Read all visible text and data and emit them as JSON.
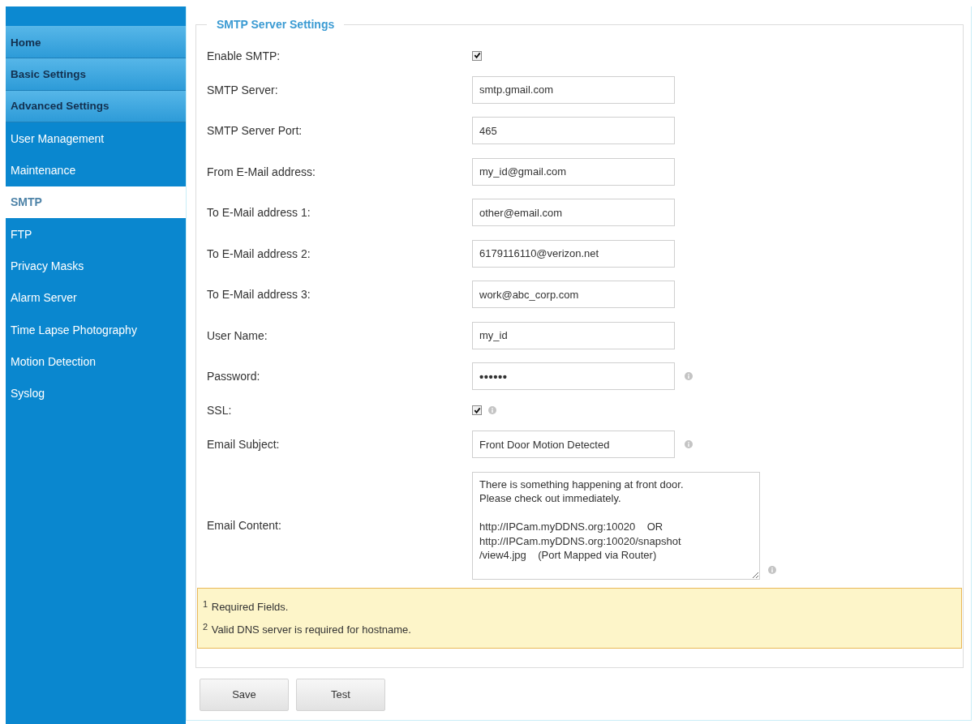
{
  "sidebar": {
    "items": [
      {
        "label": "Home",
        "kind": "section",
        "selected": false
      },
      {
        "label": "Basic Settings",
        "kind": "section",
        "selected": false
      },
      {
        "label": "Advanced Settings",
        "kind": "section",
        "selected": false
      },
      {
        "label": "User Management",
        "kind": "link",
        "selected": false
      },
      {
        "label": "Maintenance",
        "kind": "link",
        "selected": false
      },
      {
        "label": "SMTP",
        "kind": "link",
        "selected": true
      },
      {
        "label": "FTP",
        "kind": "link",
        "selected": false
      },
      {
        "label": "Privacy Masks",
        "kind": "link",
        "selected": false
      },
      {
        "label": "Alarm Server",
        "kind": "link",
        "selected": false
      },
      {
        "label": "Time Lapse Photography",
        "kind": "link",
        "selected": false
      },
      {
        "label": "Motion Detection",
        "kind": "link",
        "selected": false
      },
      {
        "label": "Syslog",
        "kind": "link",
        "selected": false
      }
    ]
  },
  "form": {
    "legend": "SMTP Server Settings",
    "fields": [
      {
        "label": "Enable SMTP:",
        "kind": "checkbox",
        "checked": true,
        "info": false
      },
      {
        "label": "SMTP Server:",
        "kind": "text",
        "value": "smtp.gmail.com",
        "info": false
      },
      {
        "label": "SMTP Server Port:",
        "kind": "text",
        "value": "465",
        "info": false
      },
      {
        "label": "From E-Mail address:",
        "kind": "text",
        "value": "my_id@gmail.com",
        "info": false
      },
      {
        "label": "To E-Mail address 1:",
        "kind": "text",
        "value": "other@email.com",
        "info": false
      },
      {
        "label": "To E-Mail address 2:",
        "kind": "text",
        "value": "6179116110@verizon.net",
        "info": false
      },
      {
        "label": "To E-Mail address 3:",
        "kind": "text",
        "value": "work@abc_corp.com",
        "info": false
      },
      {
        "label": "User Name:",
        "kind": "text",
        "value": "my_id",
        "info": false
      },
      {
        "label": "Password:",
        "kind": "password",
        "value": "••••••",
        "info": true
      },
      {
        "label": "SSL:",
        "kind": "checkbox",
        "checked": true,
        "info": true
      },
      {
        "label": "Email Subject:",
        "kind": "text",
        "value": "Front Door Motion Detected",
        "info": true
      },
      {
        "label": "Email Content:",
        "kind": "textarea",
        "value": "There is something happening at front door.\nPlease check out immediately.\n\nhttp://IPCam.myDDNS.org:10020    OR\nhttp://IPCam.myDDNS.org:10020/snapshot\n/view4.jpg    (Port Mapped via Router)",
        "info": true
      }
    ]
  },
  "notes": [
    "$^{1}$ Required Fields.",
    "$^{2}$ Valid DNS server is required for hostname."
  ],
  "buttons": [
    "Save",
    "Test"
  ]
}
